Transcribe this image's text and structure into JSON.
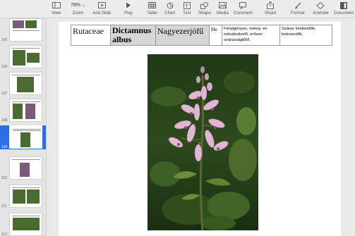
{
  "toolbar": {
    "view": "View",
    "zoom_value": "78%",
    "zoom": "Zoom",
    "add_slide": "Add Slide",
    "play": "Play",
    "table": "Table",
    "chart": "Chart",
    "text": "Text",
    "shape": "Shape",
    "media": "Media",
    "comment": "Comment",
    "share": "Share",
    "format": "Format",
    "animate": "Animate",
    "document": "Document"
  },
  "sidebar": {
    "slides": [
      {
        "num": "105"
      },
      {
        "num": "106"
      },
      {
        "num": "107"
      },
      {
        "num": "108"
      },
      {
        "num": "109",
        "selected": true
      },
      {
        "num": "110"
      },
      {
        "num": "111"
      },
      {
        "num": "112"
      }
    ]
  },
  "slide": {
    "family": "Rutaceae",
    "species": "Dictamnus albus",
    "hungarian_name": "Nagyezerjófű",
    "life_form": "He",
    "ecology": "Fényigényes, meleg- és mészkedvelő, erősen szárazságtűrő.",
    "habitat": "Száraz lomberdők, bokorerdők"
  },
  "colors": {
    "selection": "#2a6ee8",
    "species_cell_bg": "#d6d6d6"
  }
}
